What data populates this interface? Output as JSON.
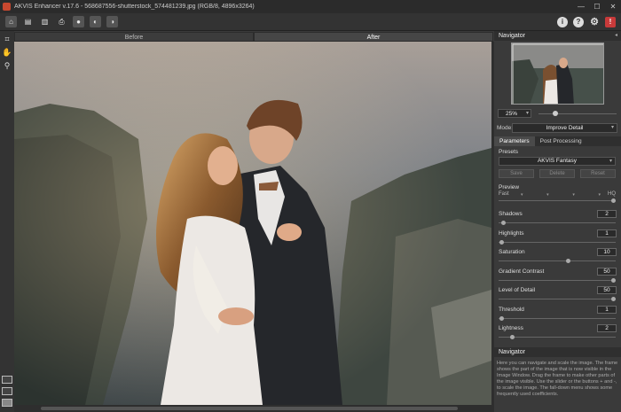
{
  "window": {
    "title": "AKVIS Enhancer v.17.6 - 568687556-shutterstock_574481239.jpg (RGB/8, 4896x3264)",
    "minimize": "—",
    "maximize": "☐",
    "close": "✕"
  },
  "toolbar": {
    "icons": [
      "home-icon",
      "open-file-icon",
      "save-file-icon",
      "print-icon",
      "batch-icon",
      "share-icon",
      "plugin-icon"
    ],
    "right_icons": [
      "info-icon",
      "help-icon",
      "settings-gear-icon",
      "notifications-icon"
    ]
  },
  "view_tabs": {
    "before": "Before",
    "after": "After"
  },
  "navigator": {
    "header": "Navigator",
    "zoom": "25%",
    "zoom_slider_fraction": 0.2
  },
  "mode": {
    "label": "Mode:",
    "value": "Improve Detail"
  },
  "param_tabs": {
    "parameters": "Parameters",
    "post_processing": "Post Processing"
  },
  "presets": {
    "label": "Presets",
    "value": "AKVIS Fantasy",
    "save": "Save",
    "delete": "Delete",
    "reset": "Reset"
  },
  "preview": {
    "label": "Preview",
    "fast": "Fast",
    "hq": "HQ",
    "fraction": 1.0
  },
  "params": [
    {
      "label": "Shadows",
      "value": "2",
      "fraction": 0.02
    },
    {
      "label": "Highlights",
      "value": "1",
      "fraction": 0.01
    },
    {
      "label": "Saturation",
      "value": "10",
      "fraction": 0.6
    },
    {
      "label": "Gradient Contrast",
      "value": "50",
      "fraction": 1.0
    },
    {
      "label": "Level of Detail",
      "value": "50",
      "fraction": 1.0
    },
    {
      "label": "Threshold",
      "value": "1",
      "fraction": 0.01
    },
    {
      "label": "Lightness",
      "value": "2",
      "fraction": 0.1
    }
  ],
  "help": {
    "header": "Navigator",
    "text": "Here you can navigate and scale the image. The frame shows the part of the image that is now visible in the Image Window. Drag the frame to make other parts of the image visible. Use the slider or the buttons + and -, to scale the image. The fall-down menu shows some frequently used coefficients."
  }
}
